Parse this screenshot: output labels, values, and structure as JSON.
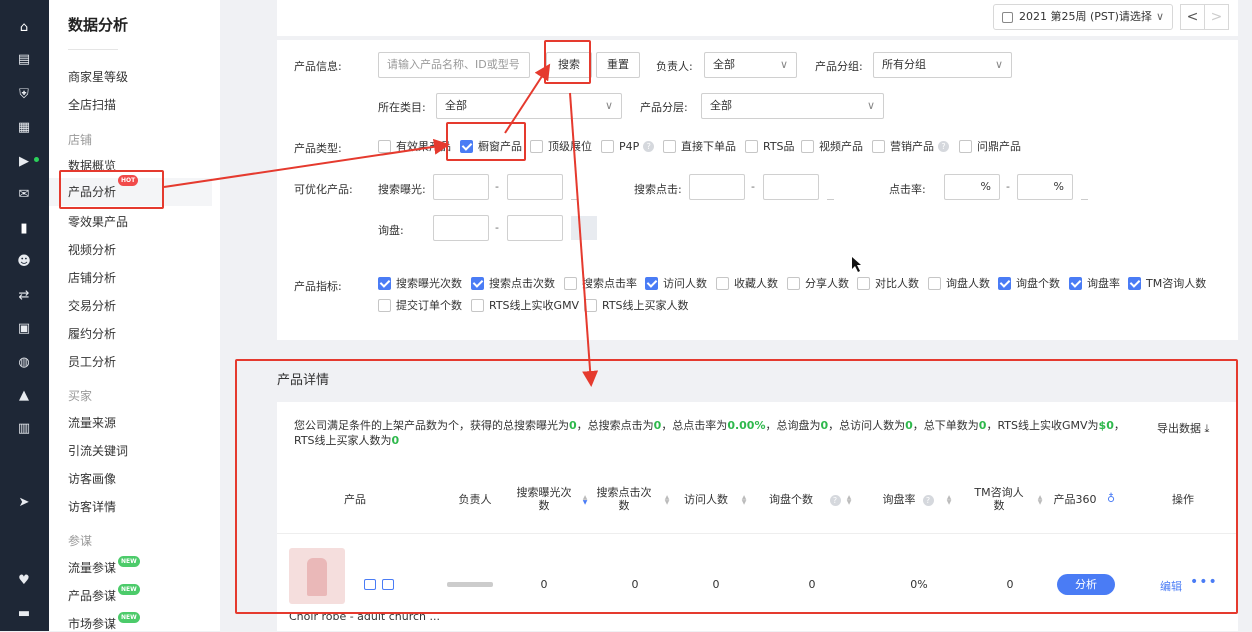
{
  "rail_icons": [
    "home-icon",
    "store-icon",
    "shield-icon",
    "grid-icon",
    "video-icon",
    "chat-icon",
    "chart-icon",
    "users-icon",
    "share-icon",
    "clipboard-icon",
    "globe-icon",
    "hat-icon",
    "bank-icon",
    "send-icon",
    "heart-icon",
    "briefcase-icon"
  ],
  "sidebar": {
    "title": "数据分析",
    "items_top": [
      "商家星等级",
      "全店扫描"
    ],
    "group_shop": "店铺",
    "items_shop": [
      "数据概览",
      "产品分析",
      "零效果产品",
      "视频分析",
      "店铺分析",
      "交易分析",
      "履约分析",
      "员工分析"
    ],
    "hot_badge": "HOT",
    "group_buyer": "买家",
    "items_buyer": [
      "流量来源",
      "引流关键词",
      "访客画像",
      "访客详情"
    ],
    "group_ref": "参谋",
    "items_ref": [
      "流量参谋",
      "产品参谋",
      "市场参谋"
    ],
    "new_badge": "NEW"
  },
  "toolbar": {
    "date_label": "2021 第25周 (PST)请选择",
    "dd_glyph": "∨",
    "prev_glyph": "<",
    "next_glyph": ">"
  },
  "filters": {
    "product_info_label": "产品信息:",
    "product_info_placeholder": "请输入产品名称、ID或型号",
    "search_button": "搜索",
    "reset_button": "重置",
    "owner_label": "负责人:",
    "owner_value": "全部",
    "group_label": "产品分组:",
    "group_value": "所有分组",
    "category_label": "所在类目:",
    "category_value": "全部",
    "layer_label": "产品分层:",
    "layer_value": "全部",
    "type_label": "产品类型:",
    "types": [
      {
        "label": "有效果产品",
        "checked": false
      },
      {
        "label": "橱窗产品",
        "checked": true
      },
      {
        "label": "顶级展位",
        "checked": false
      },
      {
        "label": "P4P",
        "checked": false,
        "help": true
      },
      {
        "label": "直接下单品",
        "checked": false
      },
      {
        "label": "RTS品",
        "checked": false
      },
      {
        "label": "视频产品",
        "checked": false
      },
      {
        "label": "营销产品",
        "checked": false,
        "help": true
      },
      {
        "label": "问鼎产品",
        "checked": false
      }
    ],
    "optimizable_label": "可优化产品:",
    "search_exposure_label": "搜索曝光:",
    "search_click_label": "搜索点击:",
    "ctr_label": "点击率:",
    "inquiry_label": "询盘:",
    "range_sep": "-",
    "percent": "%",
    "metrics_label": "产品指标:",
    "metrics": [
      {
        "label": "搜索曝光次数",
        "checked": true
      },
      {
        "label": "搜索点击次数",
        "checked": true
      },
      {
        "label": "搜索点击率",
        "checked": false
      },
      {
        "label": "访问人数",
        "checked": true
      },
      {
        "label": "收藏人数",
        "checked": false
      },
      {
        "label": "分享人数",
        "checked": false
      },
      {
        "label": "对比人数",
        "checked": false
      },
      {
        "label": "询盘人数",
        "checked": false
      },
      {
        "label": "询盘个数",
        "checked": true
      },
      {
        "label": "询盘率",
        "checked": true
      },
      {
        "label": "TM咨询人数",
        "checked": true
      },
      {
        "label": "提交订单个数",
        "checked": false
      },
      {
        "label": "RTS线上实收GMV",
        "checked": false
      },
      {
        "label": "RTS线上买家人数",
        "checked": false
      }
    ]
  },
  "details": {
    "title": "产品详情",
    "summary": {
      "p1": "您公司满足条件的上架产品数为",
      "count": "",
      "p2": "个，获得的总搜索曝光为",
      "exposure": "0",
      "p3": "，总搜索点击为",
      "clicks": "0",
      "p4": "，总点击率为",
      "ctr": "0.00%",
      "p5": "，总询盘为",
      "inquiries": "0",
      "p6": "，总访问人数为",
      "visitors": "0",
      "p7": "，总下单数为",
      "orders": "0",
      "p8": "，RTS线上实收GMV为",
      "gmv": "$0",
      "p9": "，RTS线上买家人数为",
      "buyers": "0"
    },
    "export_label": "导出数据",
    "columns": {
      "product": "产品",
      "owner": "负责人",
      "exposure": "搜索曝光次数",
      "clicks": "搜索点击次数",
      "visitors": "访问人数",
      "inquiries": "询盘个数",
      "rate": "询盘率",
      "tm": "TM咨询人数",
      "p360": "产品360",
      "ops": "操作"
    },
    "row": {
      "title": "Choir robe - adult church ...",
      "exposure": "0",
      "clicks": "0",
      "visitors": "0",
      "inquiries": "0",
      "rate": "0%",
      "tm": "0",
      "analyze": "分析",
      "edit": "编辑",
      "more": "•••"
    }
  },
  "colors": {
    "accent": "#4a7cf5",
    "annotation_red": "#e53a2e",
    "highlight_green": "#2eb84c"
  }
}
